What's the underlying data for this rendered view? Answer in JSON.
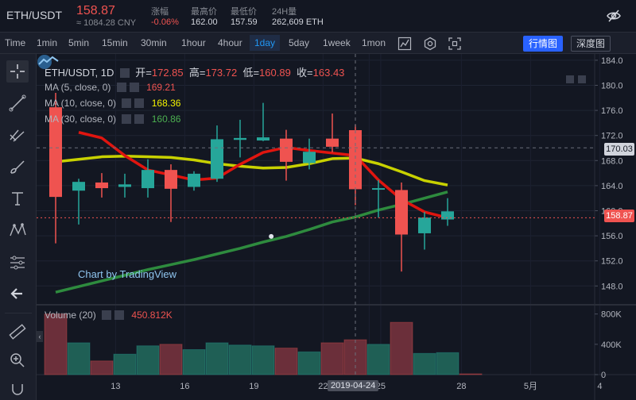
{
  "ticker": {
    "symbol": "ETH/USDT",
    "price": "158.87",
    "price_cny": "≈ 1084.28 CNY",
    "stats": [
      {
        "label": "涨幅",
        "value": "-0.06%",
        "red": true
      },
      {
        "label": "最高价",
        "value": "162.00",
        "red": false
      },
      {
        "label": "最低价",
        "value": "157.59",
        "red": false
      },
      {
        "label": "24H量",
        "value": "262,609 ETH",
        "red": false
      }
    ]
  },
  "toolbar": {
    "intervals": [
      "Time",
      "1min",
      "5min",
      "15min",
      "30min",
      "1hour",
      "4hour",
      "1day",
      "5day",
      "1week",
      "1mon"
    ],
    "active": "1day",
    "btn_market": "行情图",
    "btn_depth": "深度图"
  },
  "legend": {
    "title": "ETH/USDT, 1D",
    "open_label": "开=",
    "open": "172.85",
    "high_label": "高=",
    "high": "173.72",
    "low_label": "低=",
    "low": "160.89",
    "close_label": "收=",
    "close": "163.43",
    "ma": [
      {
        "label": "MA (5, close, 0)",
        "value": "169.21",
        "color": "#ef5350"
      },
      {
        "label": "MA (10, close, 0)",
        "value": "168.36",
        "color": "#f2f200"
      },
      {
        "label": "MA (30, close, 0)",
        "value": "160.86",
        "color": "#4caf50"
      }
    ],
    "volume_label": "Volume (20)",
    "volume_value": "450.812K",
    "watermark": "Chart by TradingView"
  },
  "price_labels": {
    "crosshair": "170.03",
    "last": "158.87"
  },
  "date_badge": "2019-04-24",
  "colors": {
    "up": "#26a69a",
    "down": "#ef5350",
    "ma5": "#e0150f",
    "ma10": "#c8d100",
    "ma30": "#2e8b3e"
  },
  "chart_data": {
    "type": "candlestick",
    "symbol": "ETH/USDT",
    "interval": "1D",
    "x_ticks": [
      "13",
      "16",
      "19",
      "22",
      "2019-04-24",
      "25",
      "28",
      "5月",
      "4"
    ],
    "y_ticks": [
      148,
      152,
      156,
      160,
      164,
      168,
      172,
      176,
      180,
      184
    ],
    "ylim": [
      145,
      185
    ],
    "candles": [
      {
        "o": 176.5,
        "h": 178.8,
        "l": 154.8,
        "c": 162.2
      },
      {
        "o": 163.2,
        "h": 165.1,
        "l": 157.8,
        "c": 164.6
      },
      {
        "o": 164.5,
        "h": 166.0,
        "l": 162.1,
        "c": 163.6
      },
      {
        "o": 163.8,
        "h": 165.9,
        "l": 162.1,
        "c": 164.2
      },
      {
        "o": 163.6,
        "h": 168.2,
        "l": 162.1,
        "c": 166.5
      },
      {
        "o": 166.5,
        "h": 167.4,
        "l": 158.2,
        "c": 163.5
      },
      {
        "o": 163.8,
        "h": 166.3,
        "l": 163.2,
        "c": 165.9
      },
      {
        "o": 165.1,
        "h": 173.6,
        "l": 164.6,
        "c": 171.4
      },
      {
        "o": 171.3,
        "h": 174.5,
        "l": 168.5,
        "c": 171.6
      },
      {
        "o": 171.2,
        "h": 177.2,
        "l": 171.1,
        "c": 171.7
      },
      {
        "o": 171.5,
        "h": 172.9,
        "l": 164.8,
        "c": 167.8
      },
      {
        "o": 167.6,
        "h": 171.5,
        "l": 166.6,
        "c": 169.4
      },
      {
        "o": 171.5,
        "h": 175.5,
        "l": 169.3,
        "c": 170.2
      },
      {
        "o": 172.85,
        "h": 173.72,
        "l": 160.89,
        "c": 163.43
      },
      {
        "o": 163.5,
        "h": 164.9,
        "l": 158.9,
        "c": 163.6
      },
      {
        "o": 163.3,
        "h": 164.5,
        "l": 150.3,
        "c": 156.2
      },
      {
        "o": 156.4,
        "h": 159.8,
        "l": 153.8,
        "c": 158.9
      },
      {
        "o": 158.6,
        "h": 162.0,
        "l": 157.59,
        "c": 159.9
      }
    ],
    "ma5": [
      null,
      172.5,
      171.6,
      168.8,
      166.5,
      165.7,
      164.9,
      165.2,
      167.4,
      169.3,
      170.1,
      169.6,
      169.2,
      168.8,
      164.9,
      161.8,
      159.8,
      158.87
    ],
    "ma10": [
      167.8,
      168.2,
      168.6,
      168.7,
      168.6,
      168.5,
      168.1,
      167.5,
      167.1,
      166.8,
      166.9,
      167.5,
      168.3,
      168.4,
      167.5,
      166.2,
      164.8,
      164.1
    ],
    "ma30": [
      147.0,
      147.9,
      148.8,
      149.7,
      150.6,
      151.4,
      152.2,
      153.1,
      154.0,
      155.0,
      155.9,
      157.0,
      158.2,
      159.0,
      160.1,
      161.0,
      162.0,
      163.0
    ],
    "volume": [
      800,
      420,
      180,
      270,
      380,
      400,
      330,
      420,
      390,
      380,
      350,
      300,
      420,
      460,
      400,
      690,
      280,
      290,
      10
    ],
    "volume_ticks": [
      "800K",
      "400K",
      "0"
    ],
    "volume_ylim": [
      0,
      880
    ]
  }
}
